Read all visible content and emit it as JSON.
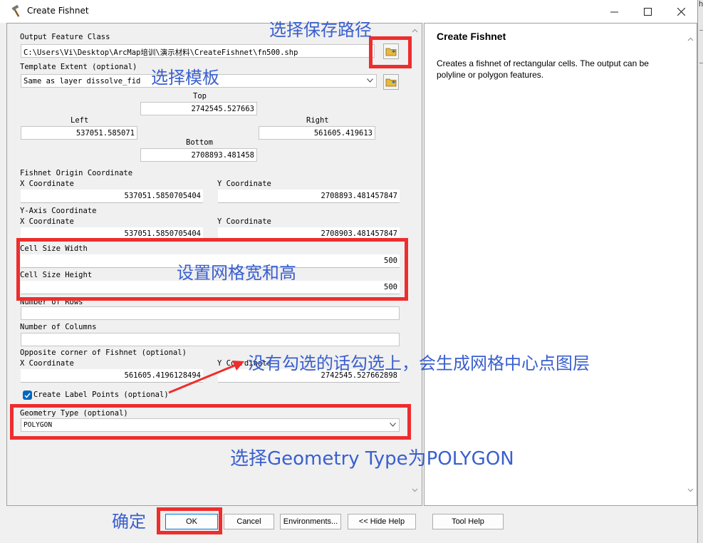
{
  "window": {
    "title": "Create Fishnet"
  },
  "right_strip": {
    "fragment": "h"
  },
  "form": {
    "output_feature_class": {
      "label": "Output Feature Class",
      "value": "C:\\Users\\Vi\\Desktop\\ArcMap培训\\演示材料\\CreateFishnet\\fn500.shp"
    },
    "template_extent": {
      "label": "Template Extent (optional)",
      "value": "Same as layer dissolve_fid"
    },
    "extent": {
      "top_label": "Top",
      "top": "2742545.527663",
      "left_label": "Left",
      "left": "537051.585071",
      "right_label": "Right",
      "right": "561605.419613",
      "bottom_label": "Bottom",
      "bottom": "2708893.481458"
    },
    "origin": {
      "label": "Fishnet Origin Coordinate",
      "x_label": "X Coordinate",
      "x": "537051.5850705404",
      "y_label": "Y Coordinate",
      "y": "2708893.481457847"
    },
    "y_axis": {
      "label": "Y-Axis Coordinate",
      "x_label": "X Coordinate",
      "x": "537051.5850705404",
      "y_label": "Y Coordinate",
      "y": "2708903.481457847"
    },
    "cell_size_width": {
      "label": "Cell Size Width",
      "value": "500"
    },
    "cell_size_height": {
      "label": "Cell Size Height",
      "value": "500"
    },
    "number_of_rows": {
      "label": "Number of Rows",
      "value": ""
    },
    "number_of_columns": {
      "label": "Number of Columns",
      "value": ""
    },
    "opposite_corner": {
      "label": "Opposite corner of Fishnet (optional)",
      "x_label": "X Coordinate",
      "x": "561605.4196128494",
      "y_label": "Y Coordinate",
      "y": "2742545.527662898"
    },
    "create_label_points": {
      "label": "Create Label Points (optional)",
      "checked": true
    },
    "geometry_type": {
      "label": "Geometry Type (optional)",
      "value": "POLYGON"
    }
  },
  "help": {
    "title": "Create Fishnet",
    "body": "Creates a fishnet of rectangular cells. The output can be polyline or polygon features."
  },
  "buttons": {
    "ok": "OK",
    "cancel": "Cancel",
    "environments": "Environments...",
    "hide_help": "<< Hide Help",
    "tool_help": "Tool Help"
  },
  "annotations": {
    "save_path": "选择保存路径",
    "template": "选择模板",
    "cell_size": "设置网格宽和高",
    "label_points": "没有勾选的话勾选上，会生成网格中心点图层",
    "geometry": "选择Geometry Type为POLYGON",
    "confirm": "确定"
  },
  "colors": {
    "annotation_text": "#3a5fcf",
    "highlight_box": "#ee2d2d",
    "checkbox": "#0067c0"
  }
}
